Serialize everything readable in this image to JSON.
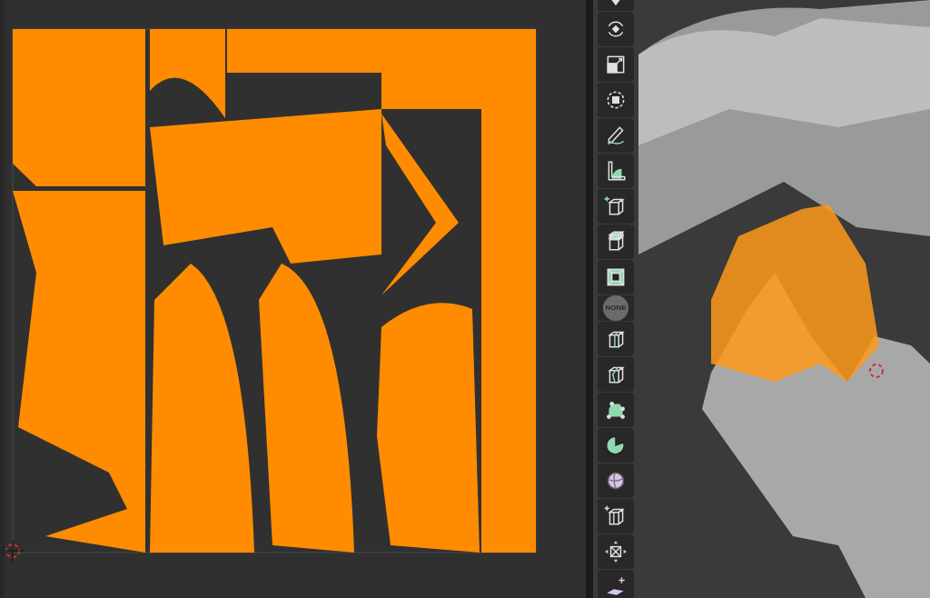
{
  "toolbar": {
    "tools": [
      {
        "kind": "move"
      },
      {
        "kind": "rotate"
      },
      {
        "kind": "scale"
      },
      {
        "kind": "transform"
      },
      {
        "kind": "annotate"
      },
      {
        "kind": "measure"
      },
      {
        "kind": "add-cube"
      },
      {
        "kind": "extrude"
      },
      {
        "kind": "inset"
      },
      {
        "kind": "label",
        "label": "NONE"
      },
      {
        "kind": "loop-cut"
      },
      {
        "kind": "knife"
      },
      {
        "kind": "poly-build"
      },
      {
        "kind": "spin"
      },
      {
        "kind": "smooth"
      },
      {
        "kind": "edge-slide"
      },
      {
        "kind": "shrink"
      },
      {
        "kind": "shear"
      }
    ]
  }
}
